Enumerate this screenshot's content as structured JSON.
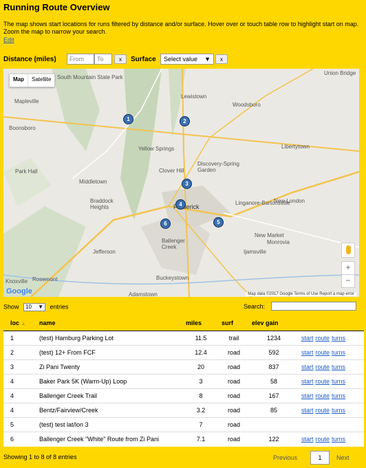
{
  "header": {
    "title": "Running Route Overview",
    "description": "The map shows start locations for runs filtered by distance and/or surface. Hover over or touch table row to highlight start on map. Zoom the map to narrow your search.",
    "edit_link": "Edit"
  },
  "filters": {
    "distance_label": "Distance (miles)",
    "from_placeholder": "From",
    "to_placeholder": "To",
    "clear_label": "x",
    "surface_label": "Surface",
    "surface_value": "Select value",
    "surface_clear_label": "x"
  },
  "map": {
    "toggle_map": "Map",
    "toggle_satellite": "Satellite",
    "markers": [
      "1",
      "2",
      "3",
      "4",
      "5",
      "6"
    ],
    "places": [
      "South Mountain State Park",
      "Lewistown",
      "Union Bridge",
      "Mapleville",
      "Woodsboro",
      "Boonsboro",
      "Libertytown",
      "Yellow Springs",
      "Clover Hill",
      "Discovery-Spring Garden",
      "Park Hall",
      "Middletown",
      "Braddock Heights",
      "Frederick",
      "Linganore-Bartonsville",
      "New London",
      "Ballenger Creek",
      "New Market",
      "Jefferson",
      "Monrovia",
      "Ijamsville",
      "Rosemont",
      "Buckeystown",
      "Knoxville",
      "Adamstown"
    ],
    "zoom_in": "+",
    "zoom_out": "−",
    "logo": "Google",
    "attribution": "Map data ©2017 Google   Terms of Use   Report a map error"
  },
  "table_controls": {
    "show_label": "Show",
    "entries_value": "10",
    "entries_label": "entries",
    "search_label": "Search:"
  },
  "table": {
    "columns": [
      "loc",
      "name",
      "miles",
      "surf",
      "elev gain"
    ],
    "rows": [
      {
        "loc": "1",
        "name": "(test) Hamburg Parking Lot",
        "miles": "11.5",
        "surf": "trail",
        "elev": "1234"
      },
      {
        "loc": "2",
        "name": "(test) 12+ From FCF",
        "miles": "12.4",
        "surf": "road",
        "elev": "592"
      },
      {
        "loc": "3",
        "name": "Zi Pani Twenty",
        "miles": "20",
        "surf": "road",
        "elev": "837"
      },
      {
        "loc": "4",
        "name": "Baker Park 5K (Warm-Up) Loop",
        "miles": "3",
        "surf": "road",
        "elev": "58"
      },
      {
        "loc": "4",
        "name": "Ballenger Creek Trail",
        "miles": "8",
        "surf": "road",
        "elev": "167"
      },
      {
        "loc": "4",
        "name": "Bentz/Fairview/Creek",
        "miles": "3.2",
        "surf": "road",
        "elev": "85"
      },
      {
        "loc": "5",
        "name": "(test) test lat/lon 3",
        "miles": "7",
        "surf": "road",
        "elev": ""
      },
      {
        "loc": "6",
        "name": "Ballenger Creek \"White\" Route from Zi Pani",
        "miles": "7.1",
        "surf": "road",
        "elev": "122"
      }
    ],
    "link_start": "start",
    "link_route": "route",
    "link_turns": "turns"
  },
  "footer": {
    "info": "Showing 1 to 8 of 8 entries",
    "previous": "Previous",
    "page": "1",
    "next": "Next"
  }
}
